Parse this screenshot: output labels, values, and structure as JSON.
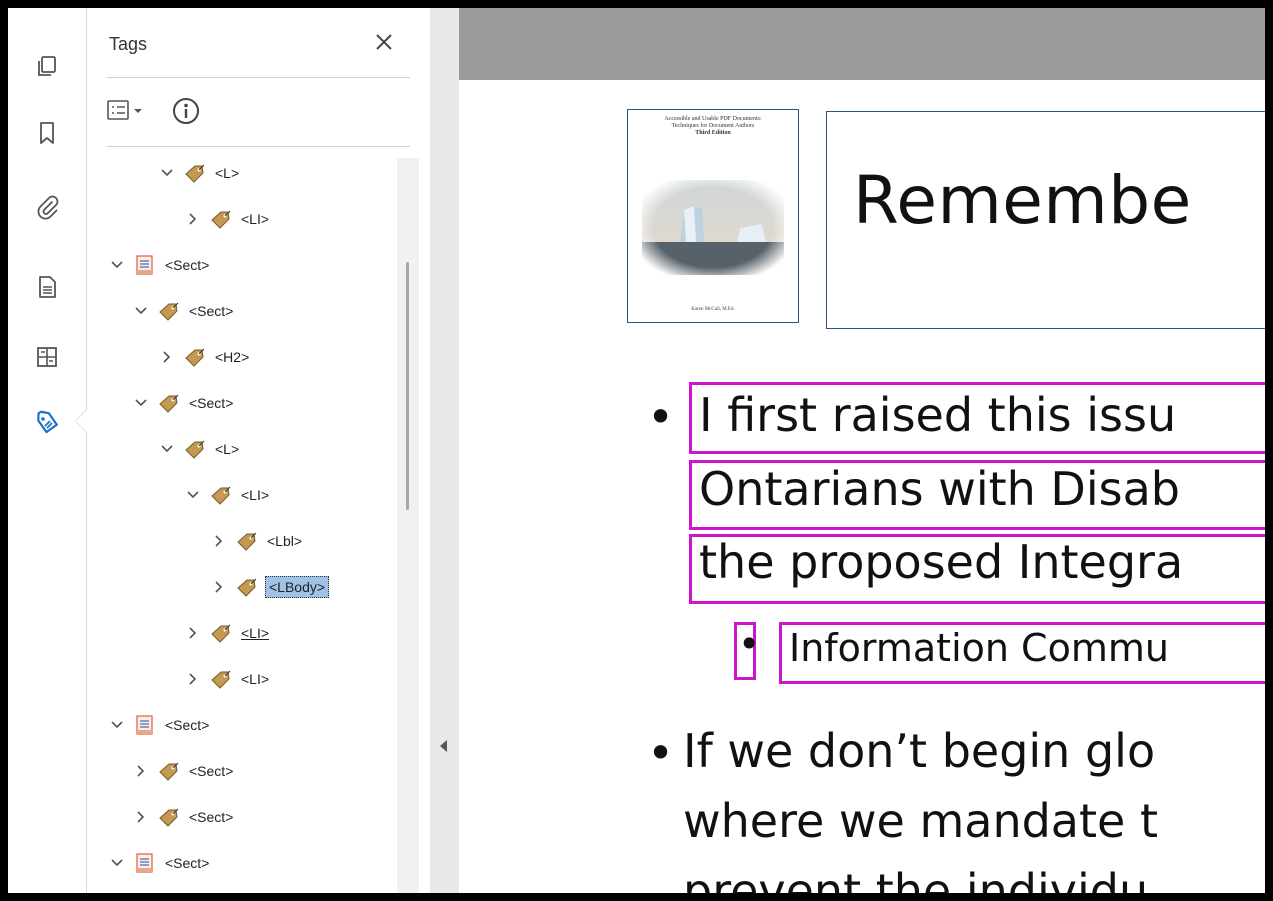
{
  "rail": {
    "icons": [
      "pages-icon",
      "bookmark-icon",
      "attachment-icon",
      "document-properties-icon",
      "content-icon",
      "tags-icon"
    ],
    "active": "tags-icon"
  },
  "panel": {
    "title": "Tags",
    "tools": {
      "options_icon": "tag-options-icon",
      "info_icon": "info-icon"
    },
    "tree": [
      {
        "label": "<L>",
        "expanded": true,
        "icon": "tag"
      },
      {
        "label": "<LI>",
        "expanded": false,
        "icon": "tag"
      },
      {
        "label": "<Sect>",
        "expanded": true,
        "icon": "page-tag"
      },
      {
        "label": "<Sect>",
        "expanded": true,
        "icon": "tag"
      },
      {
        "label": "<H2>",
        "expanded": false,
        "icon": "tag"
      },
      {
        "label": "<Sect>",
        "expanded": true,
        "icon": "tag"
      },
      {
        "label": "<L>",
        "expanded": true,
        "icon": "tag"
      },
      {
        "label": "<LI>",
        "expanded": true,
        "icon": "tag"
      },
      {
        "label": "<Lbl>",
        "expanded": false,
        "icon": "tag"
      },
      {
        "label": "<LBody>",
        "expanded": false,
        "icon": "tag",
        "selected": true
      },
      {
        "label": "<LI>",
        "expanded": false,
        "icon": "tag",
        "underlined": true
      },
      {
        "label": "<LI>",
        "expanded": false,
        "icon": "tag"
      },
      {
        "label": "<Sect>",
        "expanded": true,
        "icon": "page-tag"
      },
      {
        "label": "<Sect>",
        "expanded": false,
        "icon": "tag"
      },
      {
        "label": "<Sect>",
        "expanded": false,
        "icon": "tag"
      },
      {
        "label": "<Sect>",
        "expanded": true,
        "icon": "page-tag"
      }
    ]
  },
  "document": {
    "thumbnail": {
      "title_lines": [
        "Accessible and Usable PDF Documents:",
        "Techniques for Document Authors",
        "Third Edition"
      ],
      "footer": "Karen McCall, M.Ed."
    },
    "slide_title": "Remembe",
    "bullets": [
      {
        "text": "I first raised this issu"
      },
      {
        "text": "Ontarians with Disab"
      },
      {
        "text": "the proposed Integra"
      },
      {
        "text": "Information Commu"
      },
      {
        "text": "If we don’t begin glo"
      },
      {
        "text": "where we mandate t"
      },
      {
        "text": "prevent the individu"
      }
    ],
    "highlight_color": "#cc16cc"
  }
}
